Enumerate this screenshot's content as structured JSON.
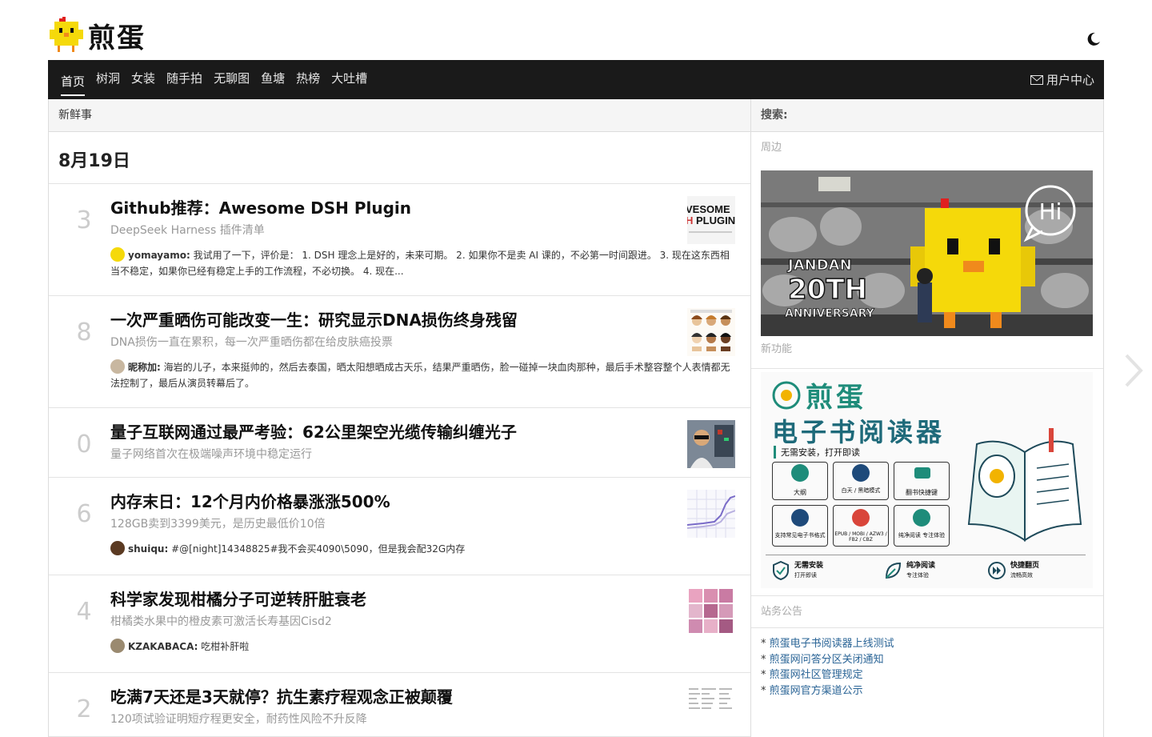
{
  "site": {
    "logo_text": "煎蛋"
  },
  "nav": {
    "items": [
      "首页",
      "树洞",
      "女装",
      "随手拍",
      "无聊图",
      "鱼塘",
      "热榜",
      "大吐槽"
    ],
    "user_center": "用户中心"
  },
  "main": {
    "panel_title": "新鲜事",
    "date": "8月19日",
    "posts": [
      {
        "count": "3",
        "title": "Github推荐：Awesome DSH Plugin",
        "subtitle": "DeepSeek Harness 插件清单",
        "comment_user": "yomayamo:",
        "comment_text": "我试用了一下，评价是： 1. DSH 理念上是好的，未来可期。 2. 如果你不是卖 AI 课的，不必第一时间跟进。 3. 现在这东西相当不稳定，如果你已经有稳定上手的工作流程，不必切换。 4. 现在...",
        "thumb_text": "AWESOME DSH PLUGIN"
      },
      {
        "count": "8",
        "title": "一次严重晒伤可能改变一生：研究显示DNA损伤终身残留",
        "subtitle": "DNA损伤一直在累积，每一次严重晒伤都在给皮肤癌投票",
        "comment_user": "昵称加:",
        "comment_text": "海岩的儿子，本来挺帅的，然后去泰国，晒太阳想晒成古天乐，结果严重晒伤，脸一碰掉一块血肉那种，最后手术整容整个人表情都无法控制了，最后从演员转幕后了。"
      },
      {
        "count": "0",
        "title": "量子互联网通过最严考验：62公里架空光缆传输纠缠光子",
        "subtitle": "量子网络首次在极端噪声环境中稳定运行"
      },
      {
        "count": "6",
        "title": "内存末日：12个月内价格暴涨涨500%",
        "subtitle": "128GB卖到3399美元，是历史最低价10倍",
        "comment_user": "shuiqu:",
        "comment_text": "#@[night]14348825#我不会买4090\\5090，但是我会配32G内存"
      },
      {
        "count": "4",
        "title": "科学家发现柑橘分子可逆转肝脏衰老",
        "subtitle": "柑橘类水果中的橙皮素可激活长寿基因Cisd2",
        "comment_user": "KZAKABACA:",
        "comment_text": "吃柑补肝啦"
      },
      {
        "count": "2",
        "title": "吃满7天还是3天就停？抗生素疗程观念正被颠覆",
        "subtitle": "120项试验证明短疗程更安全，耐药性风险不升反降"
      }
    ]
  },
  "sidebar": {
    "search_label": "搜索:",
    "nearby_label": "周边",
    "banner": {
      "line1": "JANDAN",
      "line2": "20TH",
      "line3": "ANNIVERSARY",
      "bubble": "Hi"
    },
    "new_feature_label": "新功能",
    "ereader": {
      "brand": "煎蛋",
      "title": "电子书阅读器",
      "tagline": "无需安装，打开即读",
      "features": [
        "大纲",
        "白天 / 黑暗模式",
        "翻书快捷键",
        "支持常见电子书格式",
        "EPUB / MOBI / AZW3 / FB2 / CBZ",
        "纯净阅读 专注体验"
      ],
      "bottom": [
        {
          "main": "无需安装",
          "sub": "打开即读"
        },
        {
          "main": "纯净阅读",
          "sub": "专注体验"
        },
        {
          "main": "快捷翻页",
          "sub": "流畅高效"
        }
      ]
    },
    "notice_label": "站务公告",
    "notices": [
      "煎蛋电子书阅读器上线测试",
      "煎蛋网问答分区关闭通知",
      "煎蛋网社区管理规定",
      "煎蛋网官方渠道公示"
    ]
  },
  "colors": {
    "nav_bg": "#1a1a1a",
    "link": "#2a6496",
    "accent_green": "#1e8c7a",
    "chick_yellow": "#f5d90a"
  }
}
